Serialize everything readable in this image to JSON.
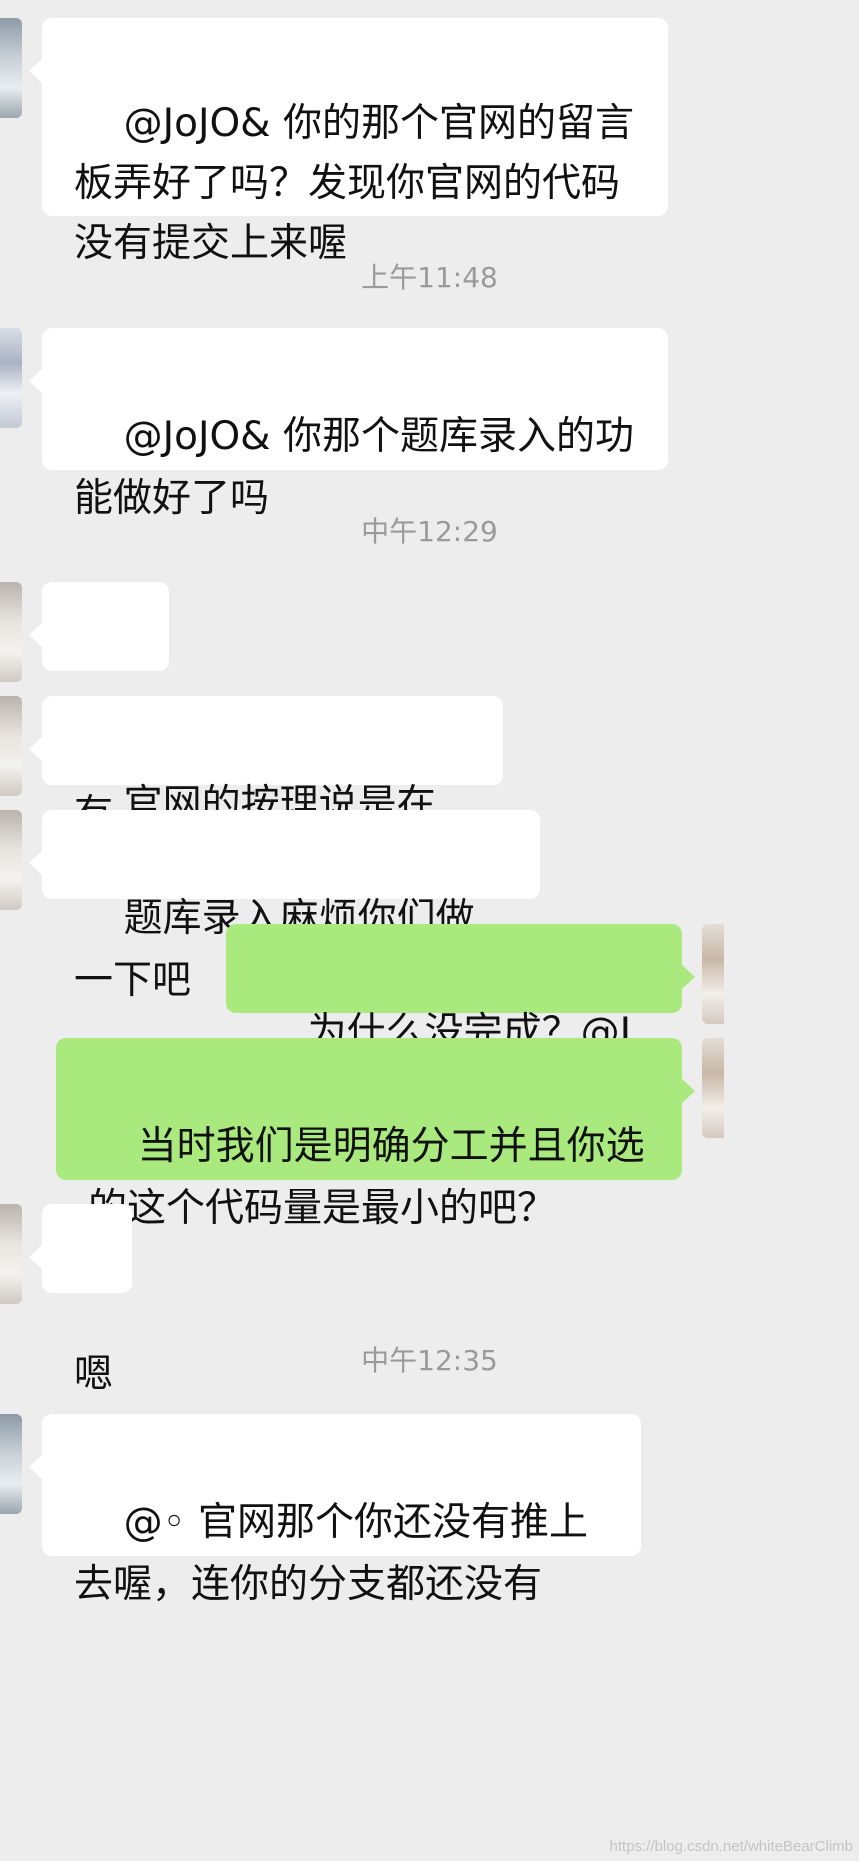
{
  "messages": [
    {
      "side": "in",
      "text": "@JoJO& 你的那个官网的留言板弄好了吗？发现你官网的代码没有提交上来喔"
    },
    {
      "type": "time",
      "text": "上午11:48"
    },
    {
      "side": "in",
      "text": "@JoJO& 你那个题库录入的功能做好了吗"
    },
    {
      "type": "time",
      "text": "中午12:29"
    },
    {
      "side": "in",
      "text": "没有"
    },
    {
      "side": "in",
      "text": "官网的按理说是在上面了"
    },
    {
      "side": "in",
      "text": "题库录入麻烦你们做一下吧"
    },
    {
      "side": "out",
      "text": "为什么没完成？@JoJO&"
    },
    {
      "side": "out",
      "text": "当时我们是明确分工并且你选的这个代码量是最小的吧？"
    },
    {
      "side": "in",
      "text": "嗯"
    },
    {
      "type": "time",
      "text": "中午12:35"
    },
    {
      "side": "in",
      "text": "@◦ 官网那个你还没有推上去喔，连你的分支都还没有"
    }
  ],
  "watermark": "https://blog.csdn.net/whiteBearClimb",
  "colors": {
    "background": "#ededed",
    "incoming_bubble": "#ffffff",
    "outgoing_bubble": "#a9e97d",
    "timestamp_text": "#9a9a9a"
  }
}
